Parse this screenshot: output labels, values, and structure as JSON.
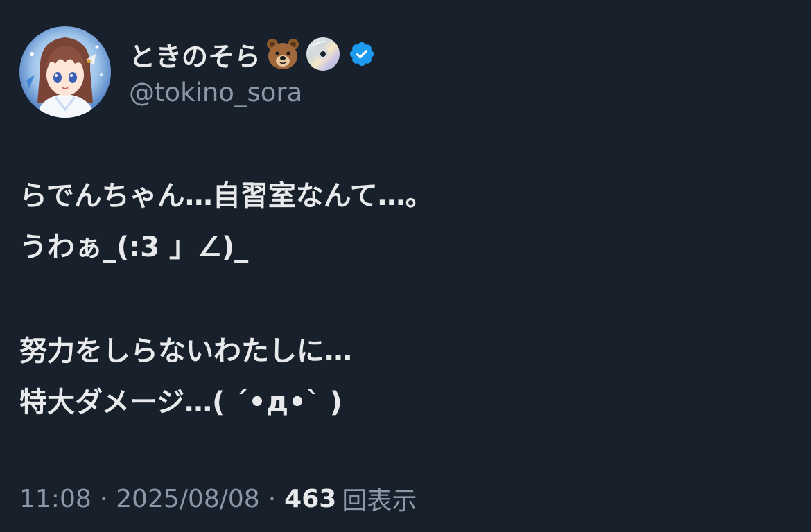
{
  "author": {
    "display_name": "ときのそら",
    "display_name_emojis": [
      "bear-face-emoji",
      "optical-disc-emoji"
    ],
    "verified_icon": "verified-badge-icon",
    "handle": "@tokino_sora",
    "avatar": "profile-avatar"
  },
  "tweet": {
    "paragraphs": [
      [
        "らでんちゃん…自習室なんて…。",
        "うわぁ_(:3 」∠)_"
      ],
      [
        "努力をしらないわたしに…",
        "特大ダメージ…( ´•д•` )"
      ]
    ]
  },
  "meta": {
    "time": "11:08",
    "separator": "·",
    "date": "2025/08/08",
    "views_count": "463",
    "views_label": "回表示"
  },
  "colors": {
    "background": "#18202b",
    "primary_text": "#e7e9ea",
    "secondary_text": "#8b98a5",
    "verified_blue": "#1d9bf0"
  }
}
